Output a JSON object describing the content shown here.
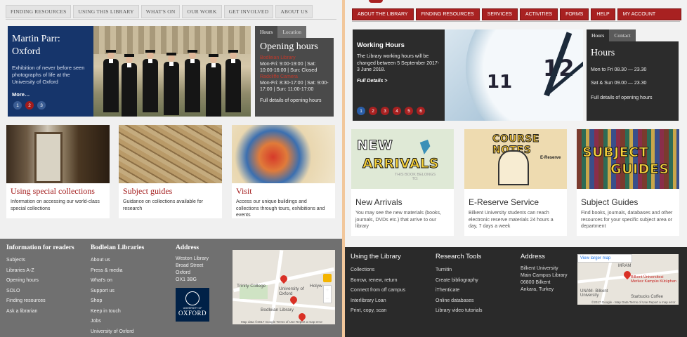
{
  "left": {
    "nav": [
      "FINDING RESOURCES",
      "USING THIS LIBRARY",
      "WHAT'S ON",
      "OUR WORK",
      "GET INVOLVED",
      "ABOUT US"
    ],
    "hero": {
      "title": "Martin Parr: Oxford",
      "text": "Exhibition of never before seen photographs of life at the University of Oxford",
      "more": "More…",
      "dots": [
        "1",
        "2",
        "3"
      ]
    },
    "hours": {
      "tabs": [
        "Hours",
        "Location"
      ],
      "title": "Opening hours",
      "sub1": "Bodleian Library",
      "lines1": "Mon-Fri: 9:00-19:00 | Sat: 10:00-16:00 | Sun: Closed",
      "sub2": "Radcliffe Camera",
      "lines2": "Mon-Fri: 8:30-17:00 | Sat: 9:00-17:00 | Sun: 11:00-17:00",
      "full": "Full details of opening hours"
    },
    "cards": [
      {
        "title": "Using special collections",
        "text": "Information on accessing our world-class special collections"
      },
      {
        "title": "Subject guides",
        "text": "Guidance on collections available for research"
      },
      {
        "title": "Visit",
        "text": "Access our unique buildings and collections through tours, exhibitions and events"
      }
    ],
    "footer": {
      "col1": {
        "title": "Information for readers",
        "items": [
          "Subjects",
          "Libraries A-Z",
          "Opening hours",
          "SOLO",
          "Finding resources",
          "Ask a librarian"
        ]
      },
      "col2": {
        "title": "Bodleian Libraries",
        "items": [
          "About us",
          "Press & media",
          "What's on",
          "Support us",
          "Shop",
          "Keep in touch",
          "Jobs",
          "University of Oxford"
        ]
      },
      "col3": {
        "title": "Address",
        "lines": [
          "Weston Library",
          "Broad Street",
          "Oxford",
          "OX1 3BG"
        ]
      },
      "logo": {
        "line1": "UNIVERSITY OF",
        "line2": "OXFORD"
      },
      "map": {
        "labels": [
          "Trinity College",
          "University of Oxford",
          "Bodleian Library",
          "Holyw"
        ],
        "zoom_in": "+",
        "zoom_out": "−",
        "footer": "Map data ©2017 Google   Terms of Use   Report a map error"
      }
    }
  },
  "right": {
    "nav": [
      "ABOUT THE LIBRARY",
      "FINDING RESOURCES",
      "SERVICES",
      "ACTIVITIES",
      "FORMS",
      "HELP",
      "MY ACCOUNT"
    ],
    "hero": {
      "title": "Working Hours",
      "text": "The Library working hours will be changed between 5 September 2017-3 June 2018.",
      "more": "Full Details >",
      "dots": [
        "1",
        "2",
        "3",
        "4",
        "5",
        "6"
      ],
      "clock": [
        "11",
        "12",
        "1"
      ]
    },
    "hours": {
      "tabs": [
        "Hours",
        "Contact"
      ],
      "title": "Hours",
      "line1": "Mon to Fri 08.30 — 23.30",
      "line2": "Sat & Sun 09.00 — 23.30",
      "full": "Full details of opening hours"
    },
    "cards": [
      {
        "title": "New Arrivals",
        "text": "You may see the new materials (books, journals, DVDs etc.) that arrive to our library",
        "banner1": "NEW",
        "banner2": "ARRIVALS",
        "banner3": "THIS BOOK BELONGS TO:"
      },
      {
        "title": "E-Reserve Service",
        "text": "Bilkent University students can reach electronic reserve materials 24 hours a day, 7 days a week",
        "banner1": "COURSE NOTES",
        "banner2": "E-Reserve"
      },
      {
        "title": "Subject Guides",
        "text": "Find books, journals, databases and other resources for your specific subject area or department",
        "banner1": "SUBJECT",
        "banner2": "GUIDES"
      }
    ],
    "footer": {
      "col1": {
        "title": "Using the Library",
        "items": [
          "Collections",
          "Borrow, renew, return",
          "Connect from off campus",
          "Interlibrary Loan",
          "Print, copy, scan"
        ]
      },
      "col2": {
        "title": "Research Tools",
        "items": [
          "Turnitin",
          "Create bibliography",
          "iThenticate",
          "Online databases",
          "Library video tutorials"
        ]
      },
      "col3": {
        "title": "Address",
        "lines": [
          "Bilkent University",
          "Main Campus Library",
          "06800 Bilkent",
          "Ankara, Turkey"
        ]
      },
      "map": {
        "view_larger": "View larger map",
        "labels": [
          "Bilkent Üniversitesi Merkez Kampüs Kütüphan",
          "UNAM- Bilkent University",
          "Starbucks Coffee",
          "MRAM"
        ],
        "footer": "©2017 Google - Map Data   Terms of Use   Report a map error"
      }
    }
  },
  "colors": {
    "oxford_blue": "#16356b",
    "bilkent_red": "#a82121",
    "footer_grey": "#707070",
    "footer_dark": "#2a2a2a"
  }
}
